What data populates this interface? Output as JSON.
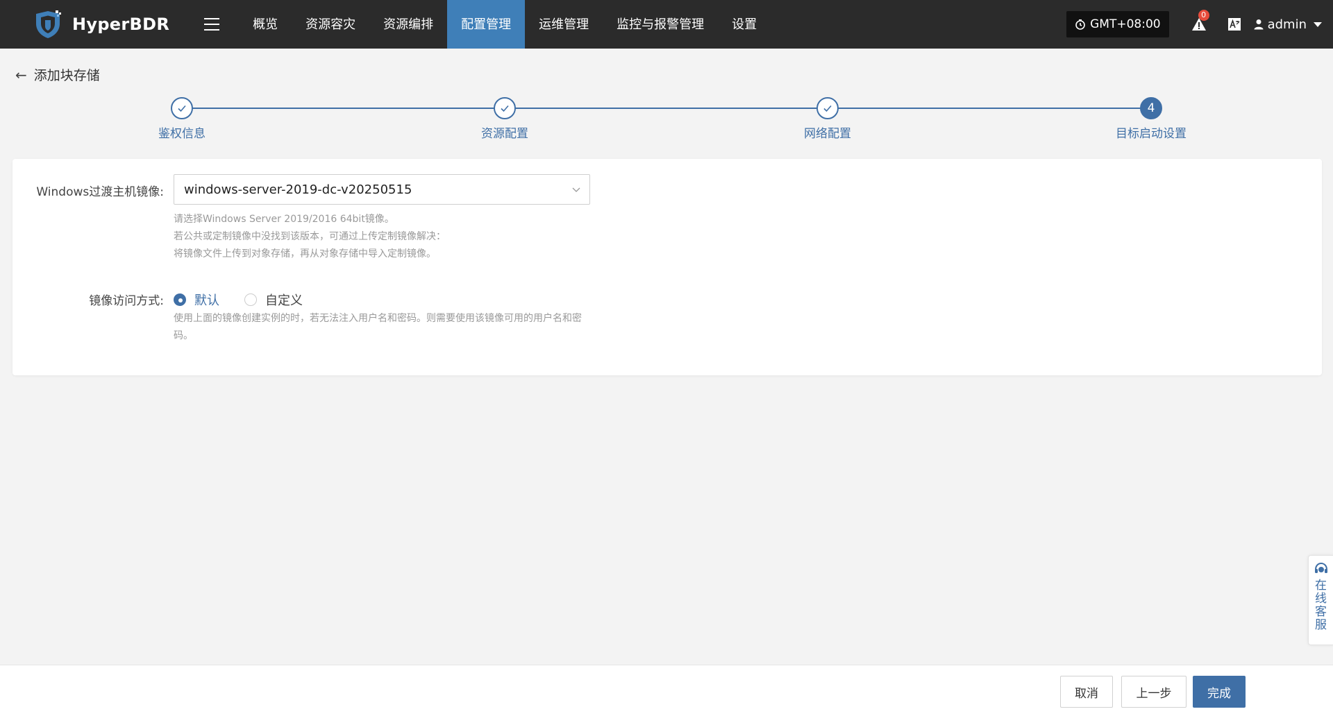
{
  "app": {
    "name": "HyperBDR"
  },
  "nav": {
    "items": [
      {
        "label": "概览"
      },
      {
        "label": "资源容灾"
      },
      {
        "label": "资源编排"
      },
      {
        "label": "配置管理"
      },
      {
        "label": "运维管理"
      },
      {
        "label": "监控与报警管理"
      },
      {
        "label": "设置"
      }
    ],
    "active_index": 3
  },
  "header_right": {
    "timezone": "GMT+08:00",
    "alert_count": "0",
    "user": "admin"
  },
  "page": {
    "title": "添加块存储"
  },
  "steps": [
    {
      "label": "鉴权信息",
      "state": "done"
    },
    {
      "label": "资源配置",
      "state": "done"
    },
    {
      "label": "网络配置",
      "state": "done"
    },
    {
      "label": "目标启动设置",
      "state": "current",
      "number": "4"
    }
  ],
  "form": {
    "image": {
      "label": "Windows过渡主机镜像:",
      "value": "windows-server-2019-dc-v20250515",
      "help": [
        "请选择Windows Server 2019/2016 64bit镜像。",
        "若公共或定制镜像中没找到该版本，可通过上传定制镜像解决：",
        "将镜像文件上传到对象存储，再从对象存储中导入定制镜像。"
      ]
    },
    "access": {
      "label": "镜像访问方式:",
      "options": [
        {
          "label": "默认",
          "checked": true
        },
        {
          "label": "自定义",
          "checked": false
        }
      ],
      "help": "使用上面的镜像创建实例的时，若无法注入用户名和密码。则需要使用该镜像可用的用户名和密码。"
    }
  },
  "footer": {
    "cancel": "取消",
    "prev": "上一步",
    "finish": "完成"
  },
  "service": {
    "label": "在线客服"
  },
  "colors": {
    "topbar": "#2b2b2b",
    "accent": "#3f6fa6",
    "nav_active": "#3f7fb8",
    "badge": "#e74c3c"
  }
}
